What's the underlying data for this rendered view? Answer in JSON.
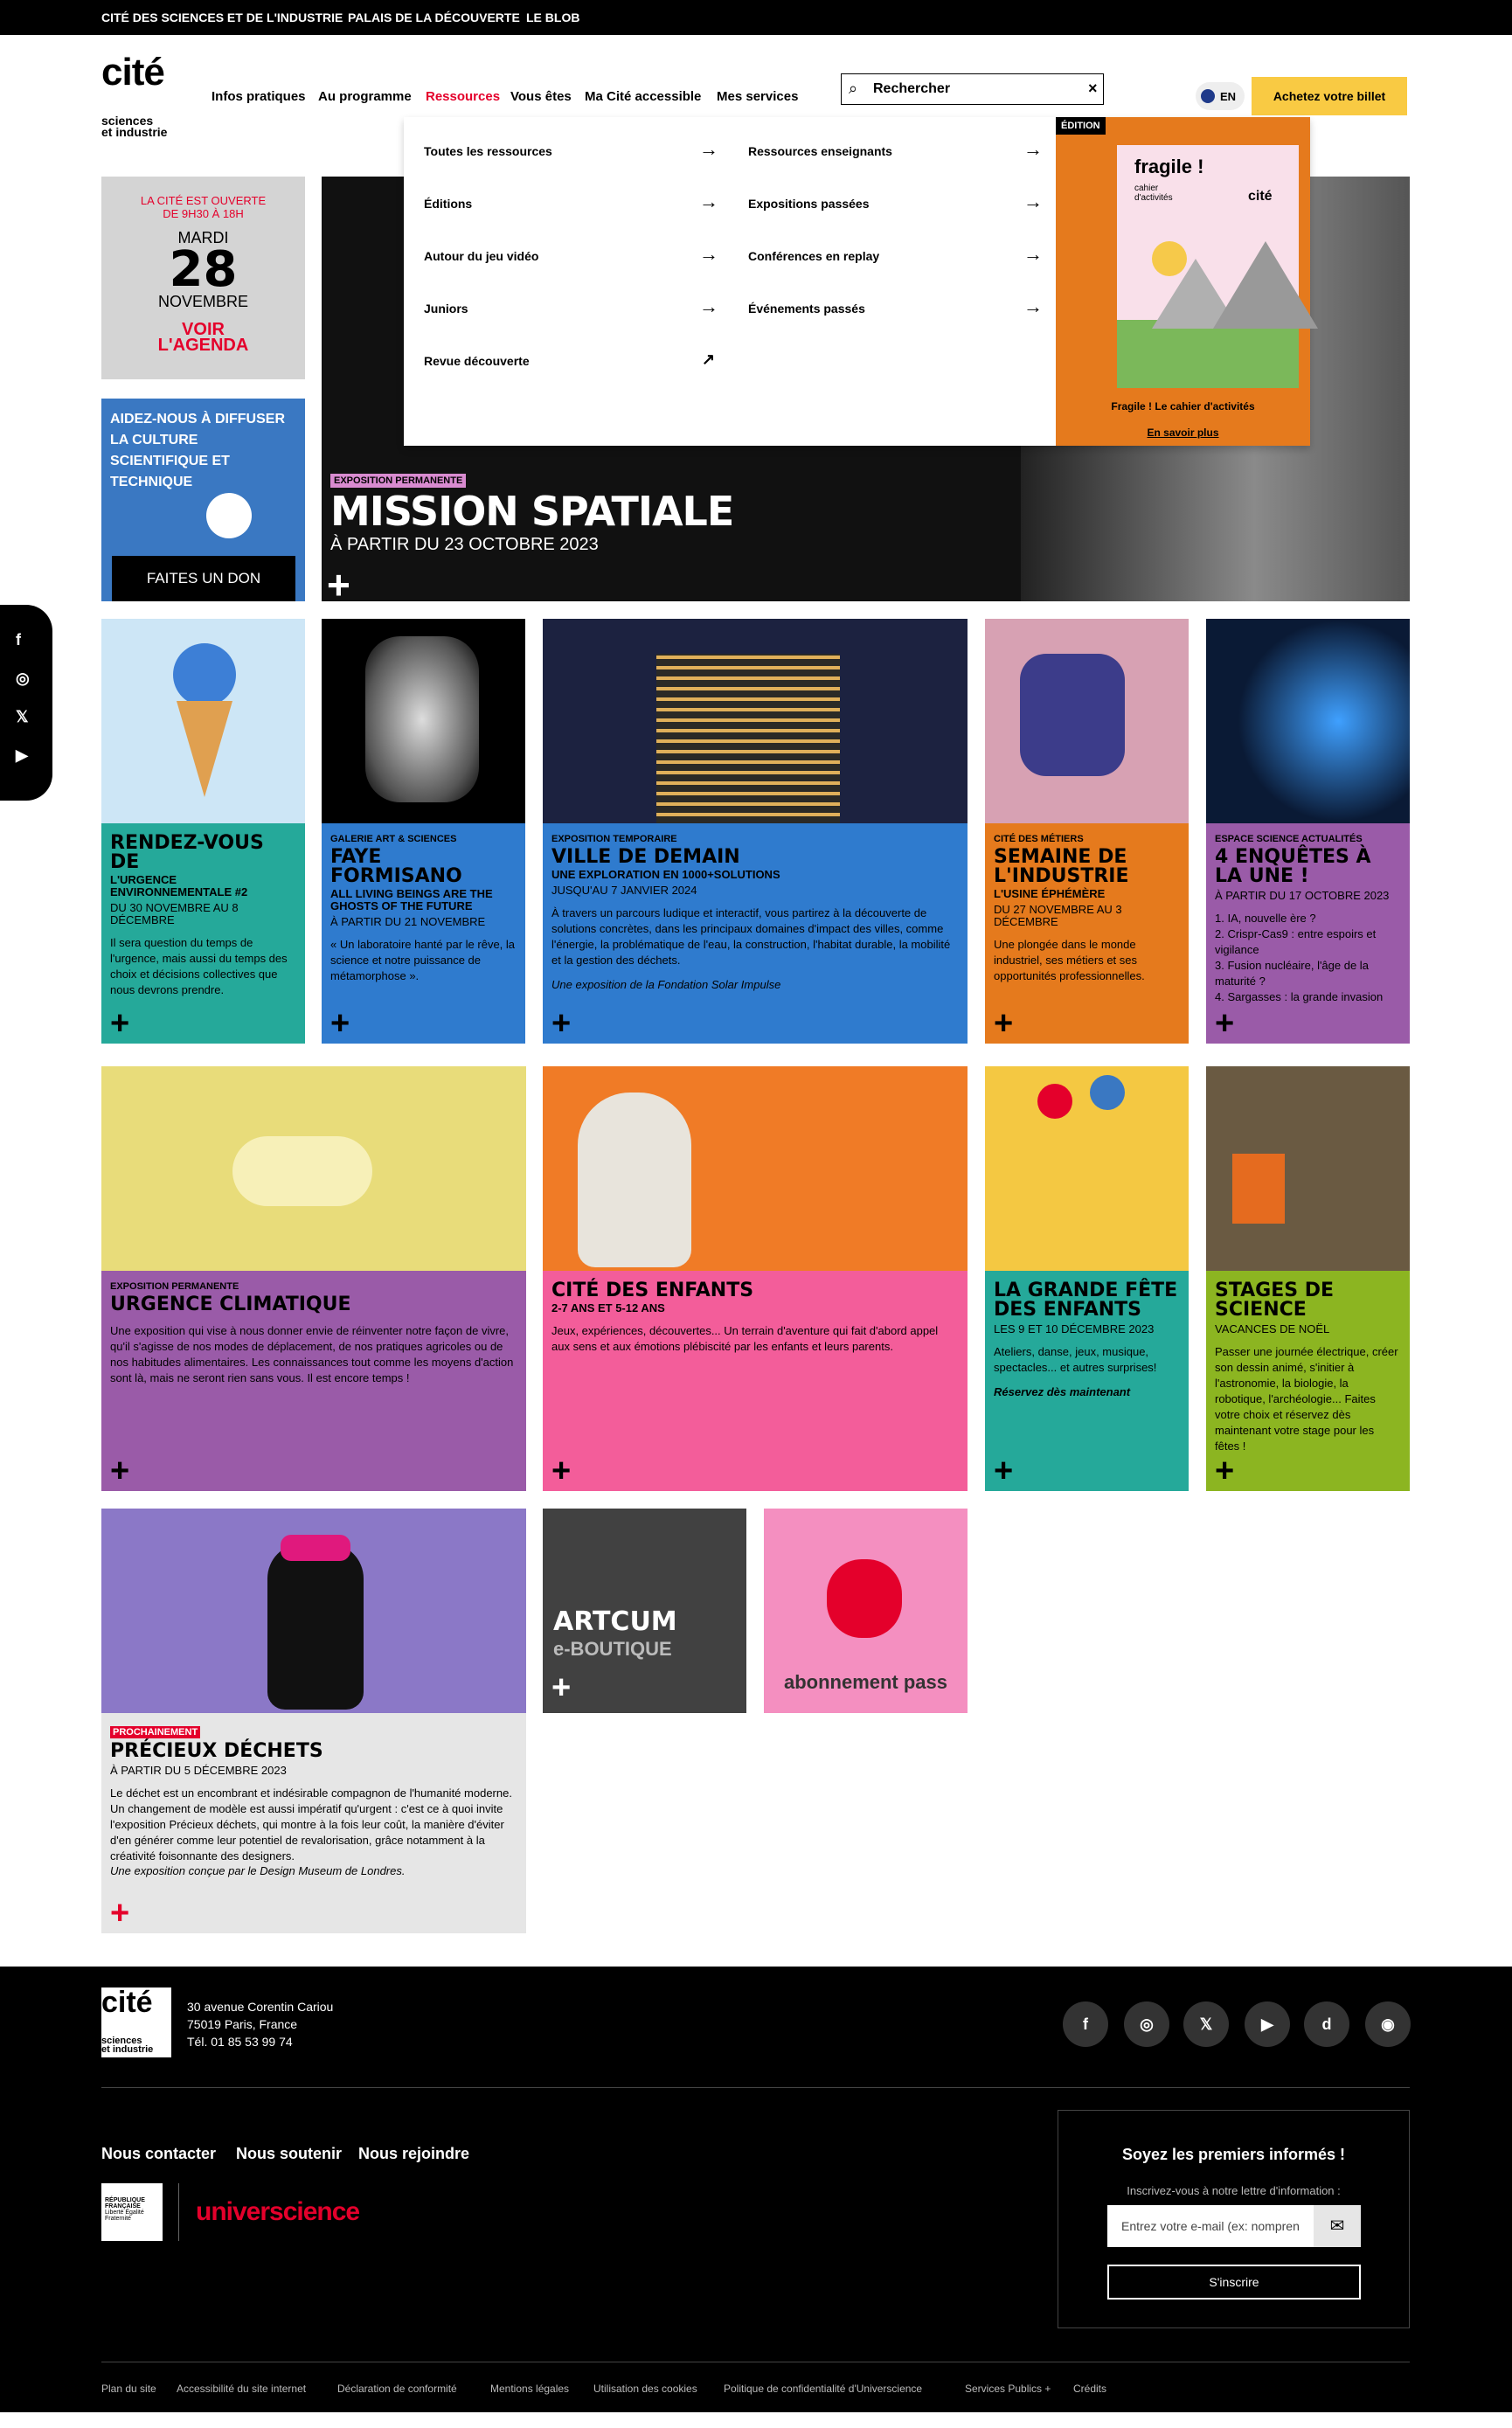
{
  "topbar": {
    "links": [
      "CITÉ DES SCIENCES ET DE L'INDUSTRIE",
      "PALAIS DE LA DÉCOUVERTE",
      "LE BLOB"
    ]
  },
  "brand": {
    "logo": "cité",
    "logo_sub1": "sciences",
    "logo_sub2": "et industrie"
  },
  "nav": {
    "items": [
      "Infos pratiques",
      "Au programme",
      "Ressources",
      "Vous êtes",
      "Ma Cité accessible",
      "Mes services"
    ],
    "active": "Ressources"
  },
  "search": {
    "placeholder": "Rechercher",
    "clear": "×"
  },
  "lang": {
    "label": "EN"
  },
  "ticket": {
    "label": "Achetez votre billet"
  },
  "dropdown": {
    "col1": [
      "Toutes les ressources",
      "Éditions",
      "Autour du jeu vidéo",
      "Juniors",
      "Revue découverte"
    ],
    "col2": [
      "Ressources enseignants",
      "Expositions passées",
      "Conférences en replay",
      "Événements passés"
    ],
    "promo": {
      "tag": "ÉDITION",
      "book_title": "fragile !",
      "book_sub": "cahier d'activités",
      "book_logo": "cité",
      "caption": "Fragile ! Le cahier d'activités",
      "link": "En savoir plus"
    }
  },
  "agenda": {
    "open_line1": "LA CITÉ EST OUVERTE",
    "open_line2": "DE 9H30 À 18H",
    "weekday": "MARDI",
    "day": "28",
    "month": "NOVEMBRE",
    "link1": "VOIR",
    "link2": "L'AGENDA"
  },
  "donate": {
    "text": "AIDEZ-NOUS À DIFFUSER LA CULTURE SCIENTIFIQUE ET TECHNIQUE",
    "button": "FAITES UN DON"
  },
  "hero": {
    "kicker": "EXPOSITION PERMANENTE",
    "title": "MISSION SPATIALE",
    "date": "À PARTIR DU 23 OCTOBRE 2023"
  },
  "cards": [
    {
      "kicker": "",
      "title": "RENDEZ-VOUS DE",
      "sub": "L'URGENCE ENVIRONNEMENTALE #2",
      "date": "DU 30 NOVEMBRE AU 8 DÉCEMBRE",
      "desc": "Il sera question du temps de l'urgence, mais aussi du temps des choix et décisions collectives que nous devrons prendre."
    },
    {
      "kicker": "GALERIE ART & SCIENCES",
      "title": "FAYE FORMISANO",
      "sub": "ALL LIVING BEINGS ARE THE GHOSTS OF THE FUTURE",
      "date": "À PARTIR DU 21 NOVEMBRE",
      "desc": "« Un laboratoire hanté par le rêve, la science et notre puissance de métamorphose »."
    },
    {
      "kicker": "EXPOSITION TEMPORAIRE",
      "title": "VILLE DE DEMAIN",
      "sub": "UNE EXPLORATION EN 1000+SOLUTIONS",
      "date": "JUSQU'AU 7 JANVIER 2024",
      "desc": "À travers un parcours ludique et interactif, vous partirez à la découverte de solutions concrètes, dans les principaux domaines d'impact des villes, comme l'énergie, la problématique de l'eau, la construction, l'habitat durable, la mobilité et la gestion des déchets.",
      "note": "Une exposition de la Fondation Solar Impulse"
    },
    {
      "kicker": "CITÉ DES MÉTIERS",
      "title": "SEMAINE DE L'INDUSTRIE",
      "sub": "L'USINE ÉPHÉMÈRE",
      "date": "DU 27 NOVEMBRE AU 3 DÉCEMBRE",
      "desc": "Une plongée dans le monde industriel, ses métiers et ses opportunités professionnelles."
    },
    {
      "kicker": "ESPACE SCIENCE ACTUALITÉS",
      "title": "4 ENQUÊTES À LA UNE !",
      "sub": "",
      "date": "À PARTIR DU 17 OCTOBRE 2023",
      "desc": "1. IA, nouvelle ère ?\n2. Crispr-Cas9 : entre espoirs et vigilance\n3. Fusion nucléaire, l'âge de la maturité ?\n4. Sargasses : la grande invasion"
    },
    {
      "kicker": "EXPOSITION PERMANENTE",
      "title": "URGENCE CLIMATIQUE",
      "sub": "",
      "date": "",
      "desc": "Une exposition qui vise à nous donner envie de réinventer notre façon de vivre, qu'il s'agisse de nos modes de déplacement, de nos pratiques agricoles ou de nos habitudes alimentaires. Les connaissances tout comme les moyens d'action sont là, mais ne seront rien sans vous. Il est encore temps !"
    },
    {
      "kicker": "",
      "title": "CITÉ DES ENFANTS",
      "sub": "2-7 ANS ET 5-12 ANS",
      "date": "",
      "desc": "Jeux, expériences, découvertes... Un terrain d'aventure qui fait d'abord appel aux sens et aux émotions plébiscité par les enfants et leurs parents."
    },
    {
      "kicker": "",
      "title": "LA GRANDE FÊTE DES ENFANTS",
      "sub": "",
      "date": "LES 9 ET 10 DÉCEMBRE 2023",
      "desc": "Ateliers, danse, jeux, musique, spectacles... et autres surprises!",
      "note": "Réservez dès maintenant"
    },
    {
      "kicker": "",
      "title": "STAGES DE SCIENCE",
      "sub": "",
      "date": "VACANCES DE NOËL",
      "desc": "Passer une journée électrique, créer son dessin animé, s'initier à l'astronomie, la biologie, la robotique, l'archéologie... Faites votre choix et réservez dès maintenant votre stage pour les fêtes !"
    },
    {
      "kicker": "PROCHAINEMENT",
      "title": "PRÉCIEUX DÉCHETS",
      "sub": "",
      "date": "À PARTIR DU 5 DÉCEMBRE 2023",
      "desc": "Le déchet est un encombrant et indésirable compagnon de l'humanité moderne. Un changement de modèle est aussi impératif qu'urgent : c'est ce à quoi invite l'exposition Précieux déchets, qui montre à la fois leur coût, la manière d'éviter d'en générer comme leur potentiel de revalorisation, grâce notamment à la créativité foisonnante des designers.",
      "note": "Une exposition conçue par le Design Museum de Londres."
    }
  ],
  "artcum": {
    "title": "ARTCUM",
    "sub": "e-BOUTIQUE"
  },
  "pass": {
    "label": "abonnement pass"
  },
  "footer": {
    "address1": "30 avenue Corentin Cariou",
    "address2": "75019 Paris, France",
    "phone": "Tél. 01 85 53 99 74",
    "links": [
      "Nous contacter",
      "Nous soutenir",
      "Nous rejoindre"
    ],
    "rf": "RÉPUBLIQUE FRANÇAISE",
    "rf_motto": "Liberté Égalité Fraternité",
    "universcience": "universcience",
    "news_title": "Soyez les premiers informés !",
    "news_sub": "Inscrivez-vous à notre lettre d'information :",
    "news_placeholder": "Entrez votre e-mail (ex: nompren",
    "news_button": "S'inscrire",
    "bottom": [
      "Plan du site",
      "Accessibilité du site internet",
      "Déclaration de conformité",
      "Mentions légales",
      "Utilisation des cookies",
      "Politique de confidentialité d'Universcience",
      "Services Publics +",
      "Crédits"
    ]
  },
  "colors": {
    "teal": "#25a99a",
    "blue": "#2f7bce",
    "orange": "#e57a1d",
    "purple": "#9a5ba8",
    "pink": "#f35d9a",
    "green": "#8cb521",
    "grey": "#e6e6e6",
    "promo": "#e57a1d",
    "ticket": "#f9ca43"
  }
}
